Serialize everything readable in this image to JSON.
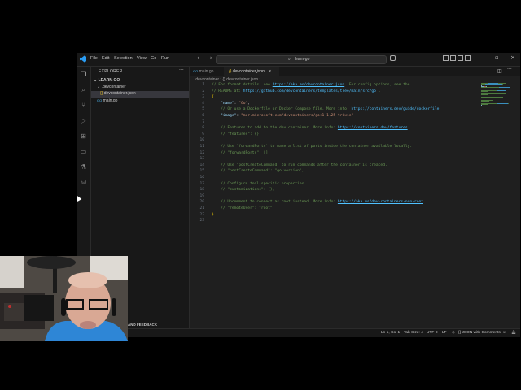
{
  "menu": [
    "File",
    "Edit",
    "Selection",
    "View",
    "Go",
    "Run"
  ],
  "menu_more": "···",
  "search": {
    "text": "learn-go"
  },
  "sidebar": {
    "title": "EXPLORER",
    "more": "···",
    "root": "LEARN-GO",
    "folder": ".devcontainer",
    "file_json": "devcontainer.json",
    "file_go": "main.go",
    "outline_label": "AND FEEDBACK"
  },
  "tabs": [
    {
      "label": "main.go"
    },
    {
      "label": "devcontainer.json"
    }
  ],
  "breadcrumb": [
    ".devcontainer",
    "{} devcontainer.json",
    "..."
  ],
  "code_lines": [
    [
      {
        "c": "cm",
        "t": "// For format details, see "
      },
      {
        "c": "lk",
        "t": "https://aka.ms/devcontainer.json"
      },
      {
        "c": "cm",
        "t": ". For config options, see the"
      }
    ],
    [
      {
        "c": "cm",
        "t": "// README at: "
      },
      {
        "c": "lk",
        "t": "https://github.com/devcontainers/templates/tree/main/src/go"
      },
      {
        "c": "cm",
        "t": " ."
      }
    ],
    [
      {
        "c": "pn",
        "t": "{"
      }
    ],
    [
      {
        "c": "key",
        "t": "    \"name\""
      },
      {
        "c": "pl",
        "t": ": "
      },
      {
        "c": "str",
        "t": "\"Go\""
      },
      {
        "c": "pl",
        "t": ","
      }
    ],
    [
      {
        "c": "cm",
        "t": "    // Or use a Dockerfile or Docker Compose file. More info: "
      },
      {
        "c": "lk",
        "t": "https://containers.dev/guide/dockerfile"
      }
    ],
    [
      {
        "c": "key",
        "t": "    \"image\""
      },
      {
        "c": "pl",
        "t": ": "
      },
      {
        "c": "str",
        "t": "\"mcr.microsoft.com/devcontainers/go:1-1.25-trixie\""
      }
    ],
    [
      {
        "c": "pl",
        "t": ""
      }
    ],
    [
      {
        "c": "cm",
        "t": "    // Features to add to the dev container. More info: "
      },
      {
        "c": "lk",
        "t": "https://containers.dev/features"
      },
      {
        "c": "cm",
        "t": "."
      }
    ],
    [
      {
        "c": "cm",
        "t": "    // \"features\": {},"
      }
    ],
    [
      {
        "c": "pl",
        "t": ""
      }
    ],
    [
      {
        "c": "cm",
        "t": "    // Use 'forwardPorts' to make a list of ports inside the container available locally."
      }
    ],
    [
      {
        "c": "cm",
        "t": "    // \"forwardPorts\": [],"
      }
    ],
    [
      {
        "c": "pl",
        "t": ""
      }
    ],
    [
      {
        "c": "cm",
        "t": "    // Use 'postCreateCommand' to run commands after the container is created."
      }
    ],
    [
      {
        "c": "cm",
        "t": "    // \"postCreateCommand\": \"go version\","
      }
    ],
    [
      {
        "c": "pl",
        "t": ""
      }
    ],
    [
      {
        "c": "cm",
        "t": "    // Configure tool-specific properties."
      }
    ],
    [
      {
        "c": "cm",
        "t": "    // \"customizations\": {},"
      }
    ],
    [
      {
        "c": "pl",
        "t": ""
      }
    ],
    [
      {
        "c": "cm",
        "t": "    // Uncomment to connect as root instead. More info: "
      },
      {
        "c": "lk",
        "t": "https://aka.ms/dev-containers-non-root"
      },
      {
        "c": "cm",
        "t": "."
      }
    ],
    [
      {
        "c": "cm",
        "t": "    // \"remoteUser\": \"root\""
      }
    ],
    [
      {
        "c": "pn",
        "t": "}"
      }
    ],
    [
      {
        "c": "pl",
        "t": ""
      }
    ]
  ],
  "statusbar": {
    "position": "Ln 1, Col 1",
    "tabsize": "Tab Size: 4",
    "encoding": "UTF-8",
    "eol": "LF",
    "language": "{} JSON with Comments"
  },
  "colors": {
    "accent": "#0078d4",
    "editor_bg": "#1f1f1f",
    "chrome_bg": "#181818"
  }
}
